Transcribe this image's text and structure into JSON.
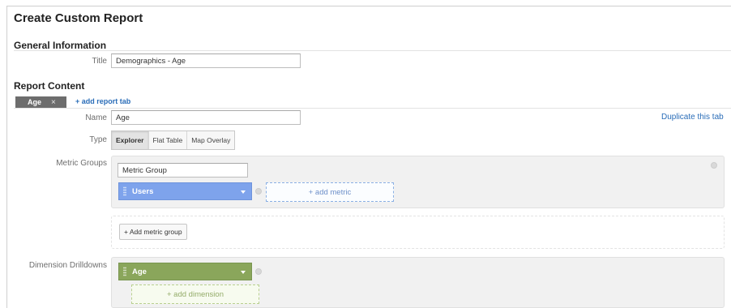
{
  "page": {
    "title": "Create Custom Report"
  },
  "general": {
    "heading": "General Information",
    "title_label": "Title",
    "title_value": "Demographics - Age"
  },
  "content": {
    "heading": "Report Content",
    "tabs": [
      {
        "label": "Age",
        "close": "×"
      }
    ],
    "add_tab": "+ add report tab",
    "duplicate_tab": "Duplicate this tab",
    "name_label": "Name",
    "name_value": "Age",
    "type_label": "Type",
    "types": [
      {
        "label": "Explorer",
        "active": true
      },
      {
        "label": "Flat Table",
        "active": false
      },
      {
        "label": "Map Overlay",
        "active": false
      }
    ],
    "metric_groups_label": "Metric Groups",
    "metric_group_name": "Metric Group",
    "metric_pill": "Users",
    "add_metric": "+ add metric",
    "add_metric_group": "+ Add metric group",
    "dimension_label": "Dimension Drilldowns",
    "dimension_pill": "Age",
    "add_dimension": "+ add dimension"
  },
  "colors": {
    "metric": "#7ea3ec",
    "dimension": "#8aa65b",
    "link": "#2a6db8"
  },
  "icons": {
    "close": "close-icon",
    "caret": "chevron-down-icon",
    "grip": "drag-handle-icon"
  }
}
